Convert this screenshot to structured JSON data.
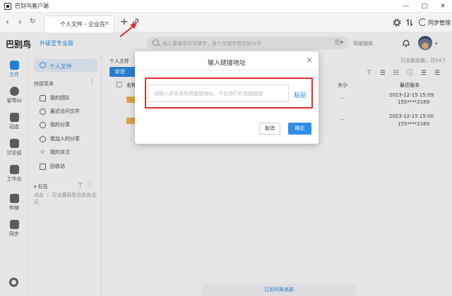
{
  "window": {
    "title": "巴别鸟客户端",
    "controls": [
      "minimize",
      "maximize",
      "close"
    ]
  },
  "tabbar": {
    "tab_label": "个人文件 - 企业在线...",
    "sync_label": "同步管理"
  },
  "header": {
    "brand": "巴别鸟",
    "upgrade": "升级至专业版",
    "search_placeholder": "输入要搜索的关键字，多个关键字用空格分开",
    "advanced_search": "高级搜索"
  },
  "rail": {
    "items": [
      {
        "label": "文件"
      },
      {
        "label": "智莺AI"
      },
      {
        "label": "动态"
      },
      {
        "label": "讨论组"
      },
      {
        "label": "工作台"
      },
      {
        "label": "传输"
      },
      {
        "label": "同步"
      }
    ]
  },
  "sidebar": {
    "active": "个人文件",
    "quick_title": "快捷菜单",
    "items": [
      {
        "label": "我的团队"
      },
      {
        "label": "最近访问文件"
      },
      {
        "label": "我的分享"
      },
      {
        "label": "我加入的分享"
      },
      {
        "label": "我的关注"
      },
      {
        "label": "回收站"
      }
    ],
    "tag_title": "标签",
    "tag_hint": "点击 ⋮ 可设置标签在此处显示"
  },
  "main": {
    "breadcrumb": "个人文件",
    "new_button": "新建",
    "loaded_text": "已全部加载，共54个",
    "columns": {
      "name": "名称",
      "size": "大小",
      "version": "最近版本"
    },
    "rows": [
      {
        "size": "--",
        "date": "2023-12-15 15:09",
        "user": "155****2169"
      },
      {
        "size": "--",
        "date": "2023-12-15 15:00",
        "user": "155****2169"
      }
    ],
    "bottom_status": "已到列表底部"
  },
  "dialog": {
    "title": "输入链接地址",
    "input_placeholder": "请输入本系统有效链接地址，不支持打开其他链接",
    "input_value": "",
    "paste_label": "粘贴",
    "cancel_label": "取消",
    "ok_label": "确定"
  },
  "colors": {
    "accent": "#2e8de8",
    "highlight": "#e22b2b",
    "folder": "#f5b54b"
  }
}
